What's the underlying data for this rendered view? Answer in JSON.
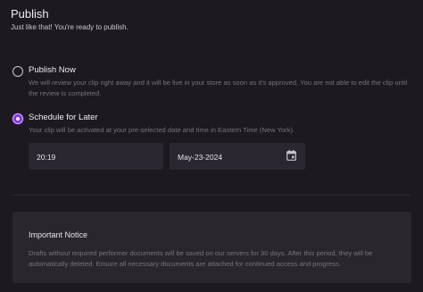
{
  "header": {
    "title": "Publish",
    "subtitle": "Just like that! You're ready to publish."
  },
  "options": [
    {
      "label": "Publish Now",
      "description": "We will review your clip right away and it will be live in your store as soon as it's approved. You are not able to edit the clip until the review is completed.",
      "selected": false
    },
    {
      "label": "Schedule for Later",
      "description": "Your clip will be activated at your pre-selected date and time in Eastern Time (New York).",
      "selected": true
    }
  ],
  "schedule": {
    "time": "20:19",
    "date": "May-23-2024",
    "date_icon": "calendar-icon"
  },
  "notice": {
    "title": "Important Notice",
    "body": "Drafts without required performer documents will be saved on our servers for 30 days. After this period, they will be automatically deleted. Ensure all necessary documents are attached for continued access and progress."
  },
  "colors": {
    "background": "#1c191f",
    "accent": "#8b2ff0",
    "field_bg": "#2a2730",
    "notice_bg": "#29262d"
  }
}
